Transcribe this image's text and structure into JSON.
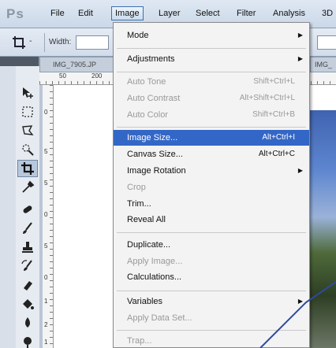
{
  "menubar": {
    "logo": "Ps",
    "items": [
      "File",
      "Edit",
      "Image",
      "Layer",
      "Select",
      "Filter",
      "Analysis",
      "3D"
    ]
  },
  "options": {
    "dash": "-",
    "width_label": "Width:"
  },
  "document": {
    "tab_title": "IMG_7905.JP",
    "tab2_title": "IMG_",
    "ruler_h": [
      "50",
      "200"
    ],
    "ruler_v": [
      "0",
      "5",
      "5",
      "0",
      "5",
      "0",
      "1",
      "2",
      "1"
    ]
  },
  "image_menu": {
    "items": [
      {
        "label": "Mode",
        "submenu": true
      },
      {
        "label": "Adjustments",
        "submenu": true
      },
      {
        "label": "Auto Tone",
        "shortcut": "Shift+Ctrl+L",
        "disabled": true
      },
      {
        "label": "Auto Contrast",
        "shortcut": "Alt+Shift+Ctrl+L",
        "disabled": true
      },
      {
        "label": "Auto Color",
        "shortcut": "Shift+Ctrl+B",
        "disabled": true
      },
      {
        "label": "Image Size...",
        "shortcut": "Alt+Ctrl+I",
        "highlighted": true
      },
      {
        "label": "Canvas Size...",
        "shortcut": "Alt+Ctrl+C"
      },
      {
        "label": "Image Rotation",
        "submenu": true
      },
      {
        "label": "Crop",
        "disabled": true
      },
      {
        "label": "Trim..."
      },
      {
        "label": "Reveal All"
      },
      {
        "label": "Duplicate..."
      },
      {
        "label": "Apply Image...",
        "disabled": true
      },
      {
        "label": "Calculations..."
      },
      {
        "label": "Variables",
        "submenu": true
      },
      {
        "label": "Apply Data Set...",
        "disabled": true
      },
      {
        "label": "Trap...",
        "disabled": true
      }
    ]
  },
  "colors": {
    "highlight": "#3367c7",
    "callout_line": "#2d4a9e"
  }
}
